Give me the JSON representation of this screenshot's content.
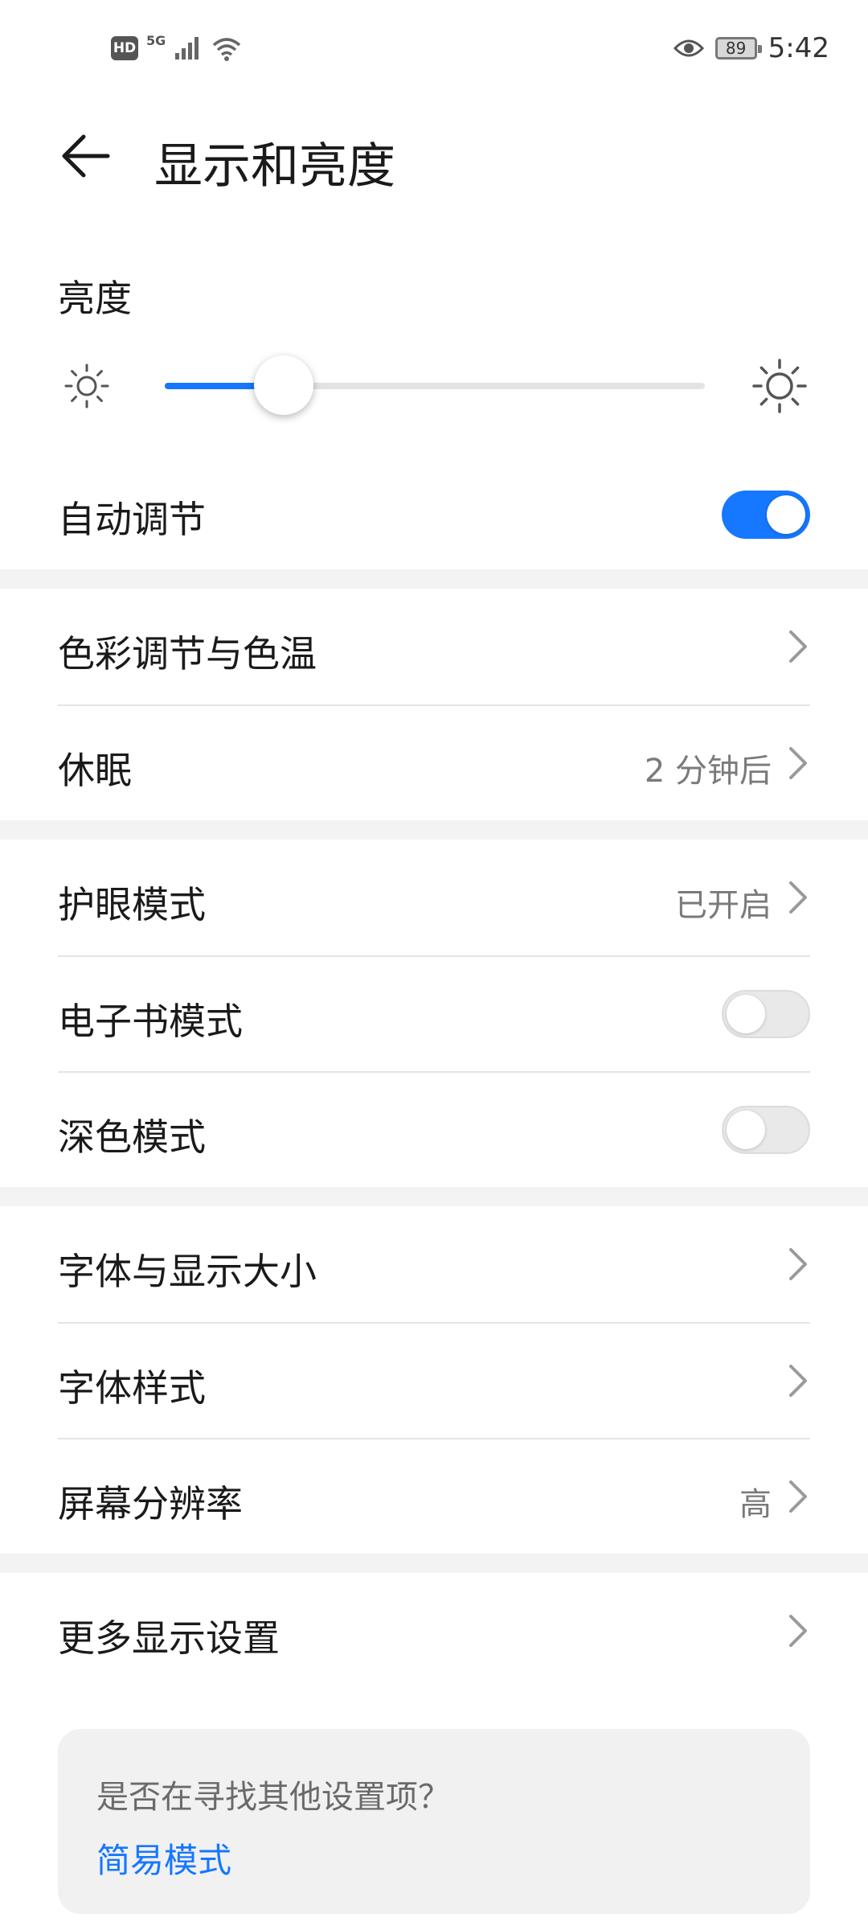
{
  "status_bar": {
    "hd": "HD",
    "net": "5G",
    "battery": "89",
    "time": "5:42"
  },
  "header": {
    "title": "显示和亮度"
  },
  "brightness": {
    "label": "亮度",
    "level_fraction": 0.22
  },
  "auto_adjust": {
    "label": "自动调节",
    "enabled": true
  },
  "rows": {
    "color_temp": {
      "label": "色彩调节与色温"
    },
    "sleep": {
      "label": "休眠",
      "value": "2 分钟后"
    },
    "eye_comfort": {
      "label": "护眼模式",
      "value": "已开启"
    },
    "ebook_mode": {
      "label": "电子书模式",
      "enabled": false
    },
    "dark_mode": {
      "label": "深色模式",
      "enabled": false
    },
    "font_size": {
      "label": "字体与显示大小"
    },
    "font_style": {
      "label": "字体样式"
    },
    "resolution": {
      "label": "屏幕分辨率",
      "value": "高"
    },
    "more_display": {
      "label": "更多显示设置"
    }
  },
  "suggestion_card": {
    "question": "是否在寻找其他设置项？",
    "link": "简易模式"
  },
  "colors": {
    "accent": "#1677ff",
    "text_primary": "#1a1a1a",
    "text_secondary": "#7a7a7a",
    "section_gap": "#f3f3f3"
  }
}
